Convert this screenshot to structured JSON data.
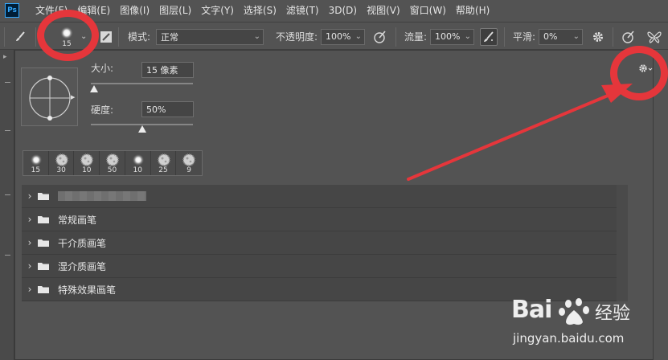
{
  "app": {
    "logo": "Ps"
  },
  "menu": [
    "文件(F)",
    "编辑(E)",
    "图像(I)",
    "图层(L)",
    "文字(Y)",
    "选择(S)",
    "滤镜(T)",
    "3D(D)",
    "视图(V)",
    "窗口(W)",
    "帮助(H)"
  ],
  "options_bar": {
    "tool_icon": "brush-icon",
    "brush_size": "15",
    "mode_label": "模式:",
    "mode_value": "正常",
    "opacity_label": "不透明度:",
    "opacity_value": "100%",
    "flow_label": "流量:",
    "flow_value": "100%",
    "smoothing_label": "平滑:",
    "smoothing_value": "0%"
  },
  "brush_panel": {
    "size_label": "大小:",
    "size_value": "15 像素",
    "size_fraction": 0.03,
    "hardness_label": "硬度:",
    "hardness_value": "50%",
    "hardness_fraction": 0.5,
    "presets": [
      {
        "size": "15",
        "style": "soft"
      },
      {
        "size": "30",
        "style": "texture"
      },
      {
        "size": "10",
        "style": "texture"
      },
      {
        "size": "50",
        "style": "texture"
      },
      {
        "size": "10",
        "style": "soft"
      },
      {
        "size": "25",
        "style": "texture"
      },
      {
        "size": "9",
        "style": "texture"
      }
    ],
    "folders": [
      {
        "label": "",
        "blurred": true
      },
      {
        "label": "常规画笔"
      },
      {
        "label": "干介质画笔"
      },
      {
        "label": "湿介质画笔"
      },
      {
        "label": "特殊效果画笔"
      }
    ]
  },
  "annotation_color": "#e5363b",
  "watermark": {
    "brand": "Bai",
    "product": "经验",
    "url": "jingyan.baidu.com"
  }
}
